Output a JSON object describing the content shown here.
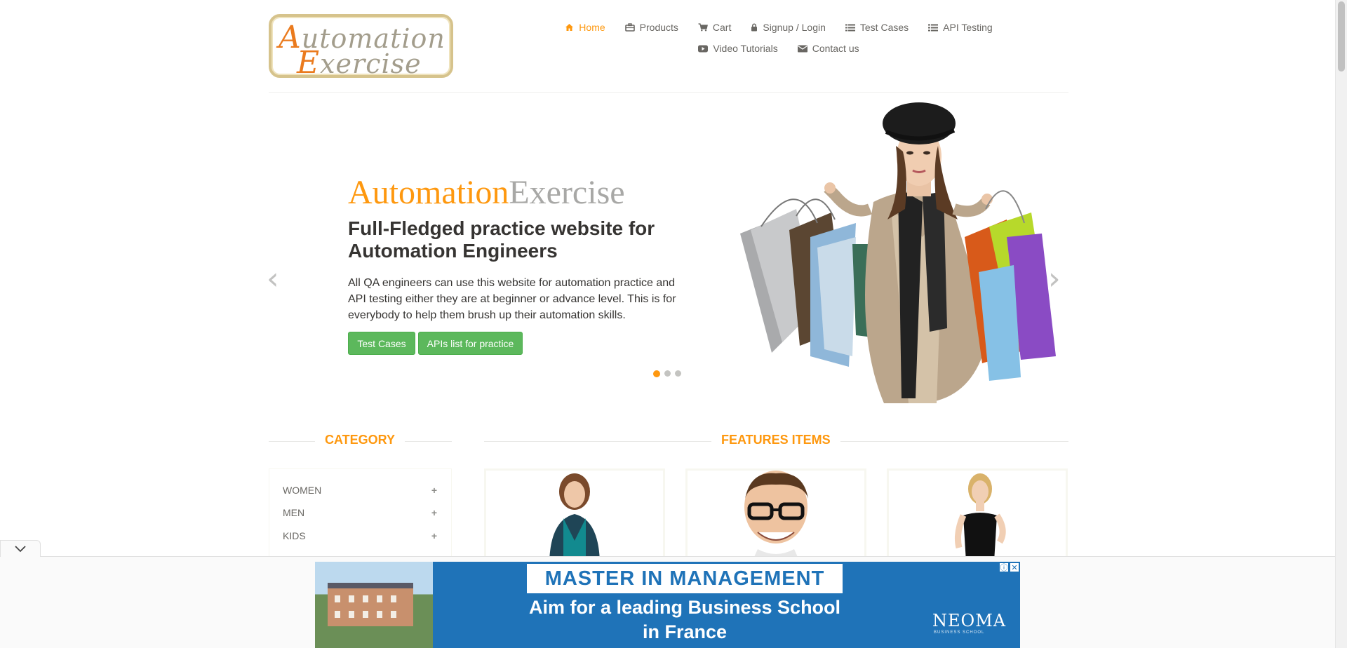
{
  "logo": {
    "line1_cap": "A",
    "line1_rest": "utomation",
    "line2_cap": "E",
    "line2_rest": "xercise"
  },
  "nav": {
    "items": [
      {
        "label": "Home",
        "icon": "home-icon"
      },
      {
        "label": "Products",
        "icon": "products-icon"
      },
      {
        "label": "Cart",
        "icon": "cart-icon"
      },
      {
        "label": "Signup / Login",
        "icon": "lock-icon"
      },
      {
        "label": "Test Cases",
        "icon": "list-icon"
      },
      {
        "label": "API Testing",
        "icon": "list-icon"
      },
      {
        "label": "Video Tutorials",
        "icon": "youtube-icon"
      },
      {
        "label": "Contact us",
        "icon": "envelope-icon"
      }
    ],
    "active": "Home"
  },
  "hero": {
    "brand_part1": "Automation",
    "brand_part2": "Exercise",
    "title": "Full-Fledged practice website for Automation Engineers",
    "text": "All QA engineers can use this website for automation practice and API testing either they are at beginner or advance level. This is for everybody to help them brush up their automation skills.",
    "button_test_cases": "Test Cases",
    "button_apis": "APIs list for practice",
    "active_slide": 1,
    "slide_count": 3
  },
  "sections": {
    "category_title": "CATEGORY",
    "features_title": "FEATURES ITEMS"
  },
  "categories": [
    {
      "label": "WOMEN"
    },
    {
      "label": "MEN"
    },
    {
      "label": "KIDS"
    }
  ],
  "ad": {
    "headline": "MASTER IN MANAGEMENT",
    "subline1": "Aim for a leading Business School",
    "subline2": "in France",
    "brand": "NEOMA",
    "brand_sub": "BUSINESS SCHOOL",
    "info_glyph": "ⓘ",
    "close_glyph": "✕"
  },
  "colors": {
    "accent": "#fe980f",
    "button_green": "#5cb85c",
    "ad_blue": "#1f73b8"
  }
}
